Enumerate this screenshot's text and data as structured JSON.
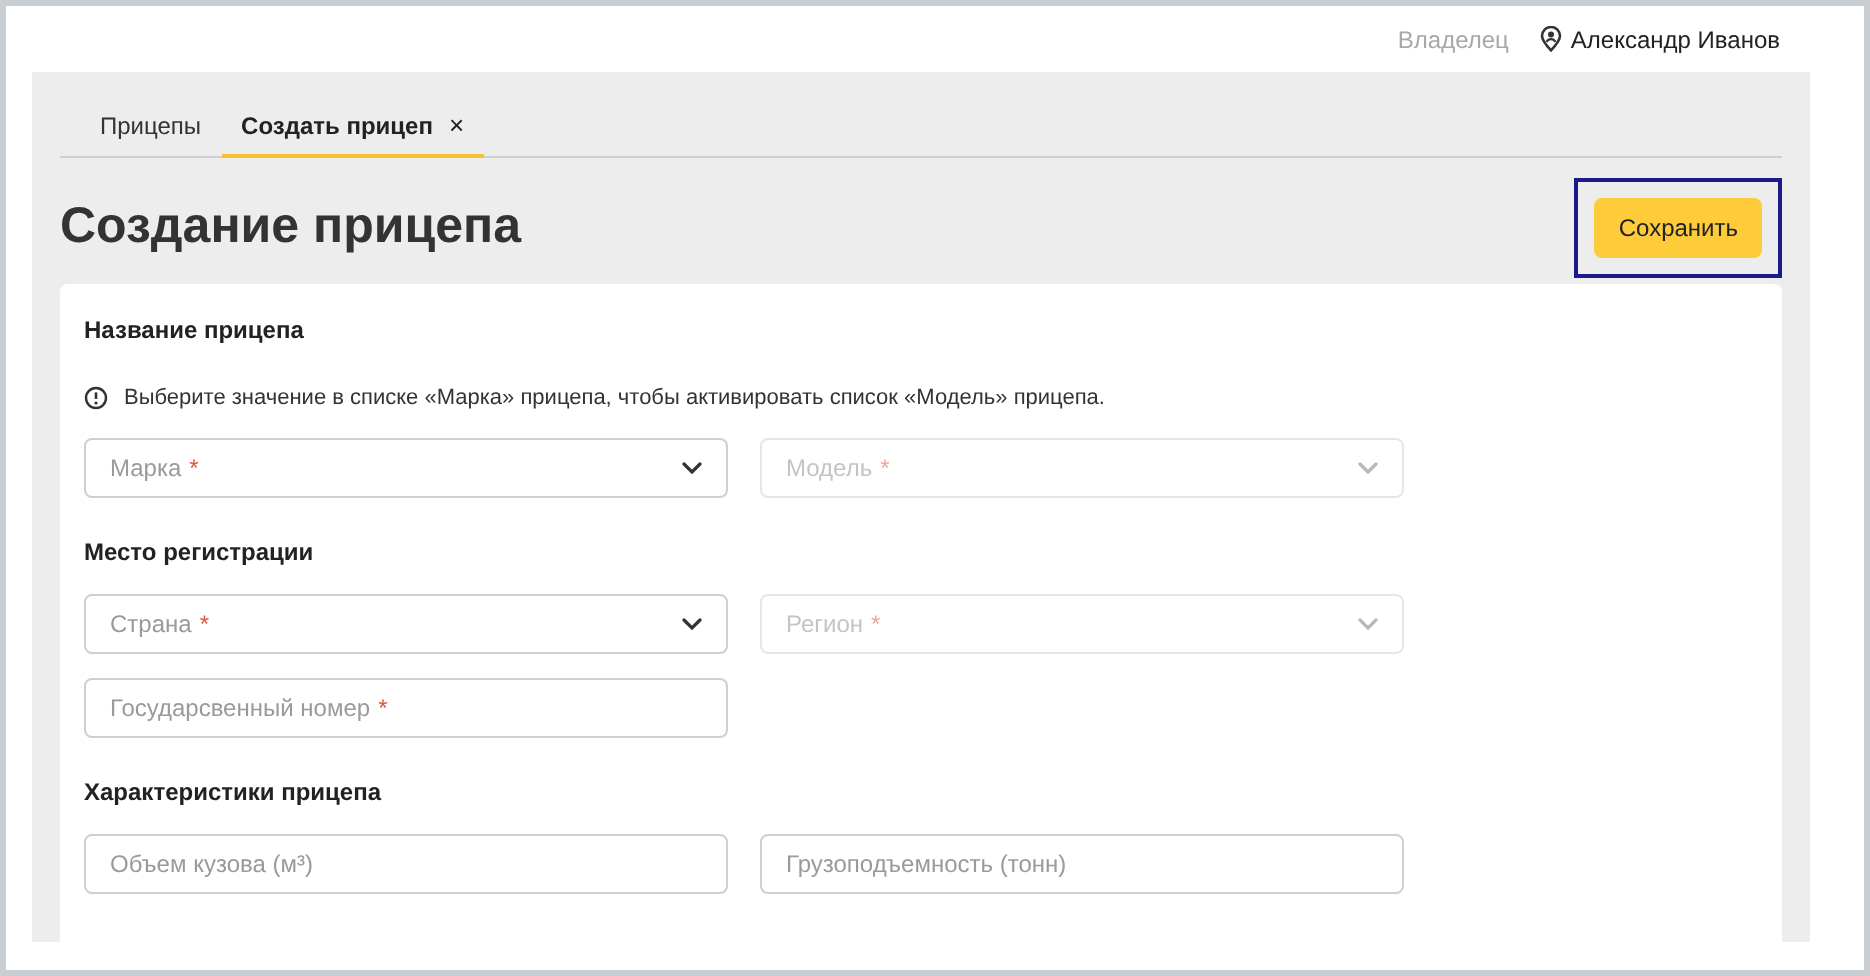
{
  "header": {
    "role": "Владелец",
    "user": "Александр Иванов"
  },
  "tabs": [
    {
      "label": "Прицепы",
      "selected": false
    },
    {
      "label": "Создать прицеп",
      "selected": true,
      "close": "×"
    }
  ],
  "title": "Создание прицепа",
  "save_button": {
    "label": "Сохранить",
    "focused": true
  },
  "sections": [
    {
      "title": "Название прицепа",
      "notice": "Выберите значение в списке «Марка» прицепа, чтобы активировать список «Модель» прицепа.",
      "rows": [
        [
          {
            "kind": "select",
            "placeholder": "Марка",
            "required_mark": "*",
            "disabled": false
          },
          {
            "kind": "select",
            "placeholder": "Модель",
            "required_mark": "*",
            "disabled": true
          }
        ]
      ]
    },
    {
      "title": "Место регистрации",
      "rows": [
        [
          {
            "kind": "select",
            "placeholder": "Страна",
            "required_mark": "*",
            "disabled": false
          },
          {
            "kind": "select",
            "placeholder": "Регион",
            "required_mark": "*",
            "disabled": true
          }
        ],
        [
          {
            "kind": "input",
            "placeholder": "Государсвенный номер",
            "required_mark": "*",
            "disabled": false
          }
        ]
      ]
    },
    {
      "title": "Характеристики прицепа",
      "rows": [
        [
          {
            "kind": "input",
            "placeholder": "Объем кузова (м³)",
            "disabled": false
          },
          {
            "kind": "input",
            "placeholder": "Грузоподъемность (тонн)",
            "disabled": false
          }
        ]
      ]
    }
  ]
}
